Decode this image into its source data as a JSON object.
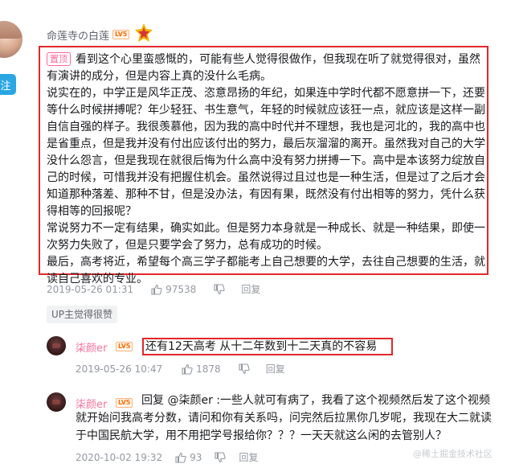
{
  "main_comment": {
    "username": "命莲寺の白莲",
    "level": "LV5",
    "pinned_label": "置顶",
    "paragraphs": [
      "看到这个心里蛮感慨的，可能有些人觉得很做作，但我现在听了就觉得很对，虽然有演讲的成分，但是内容上真的没什么毛病。",
      "说实在的，中学正是风华正茂、恣意昂扬的年纪，如果连中学时代都不愿意拼一下，还要等什么时候拼搏呢？年少轻狂、书生意气，年轻的时候就应该狂一点，就应该是这样一副自信自强的样子。我很羡慕他，因为我的高中时代并不理想，我也是河北的，我的高中也是省重点，但是我并没有付出应该付出的努力，最后灰溜溜的离开。虽然我对自己的大学没什么怨言，但是我现在就很后悔为什么高中没有努力拼搏一下。高中是本该努力绽放自己的时候，可惜我并没有把握住机会。虽然说得过且过也是一种生活，但是过了之后才会知道那种落差、那种不甘，但是没办法，有因有果，既然没有付出相等的努力，凭什么获得相等的回报呢？",
      "常说努力不一定有结果，确实如此。但是努力本身就是一种成长、就是一种结果，即使一次努力失败了，但是只要学会了努力，总有成功的时候。",
      "最后，高考将近，希望每个高三学子都能考上自己想要的大学，去往自己想要的生活，就读自己喜欢的专业。"
    ],
    "timestamp": "2019-05-26 01:31",
    "likes": "97538",
    "reply_label": "回复",
    "up_liked_label": "UP主觉得很赞"
  },
  "replies": [
    {
      "username": "柒颜er",
      "level": "LV5",
      "text": "还有12天高考 从十二年数到十二天真的不容易",
      "timestamp": "2019-05-26 10:47",
      "likes": "1878",
      "reply_label": "回复"
    },
    {
      "username": "柒颜er",
      "level": "LV5",
      "prefix": "回复 ",
      "mention": "@柒颜er",
      "text": " :一些人就可有病了，我看了这个视频然后发了这个视频就开始问我高考分数，请问和你有关系吗，问完然后拉黑你几岁呢，我现在大二就读于中国民航大学，用不用把学号报给你？？？一天天就这么闲的去管别人？",
      "timestamp": "2020-10-02 19:32",
      "likes": "93",
      "reply_label": "回复"
    }
  ],
  "follow_label": "注",
  "watermark": "@稀土掘金技术社区",
  "colors": {
    "highlight_border": "#e3272b",
    "username_pink": "#fb7299",
    "meta_gray": "#9499a0"
  }
}
